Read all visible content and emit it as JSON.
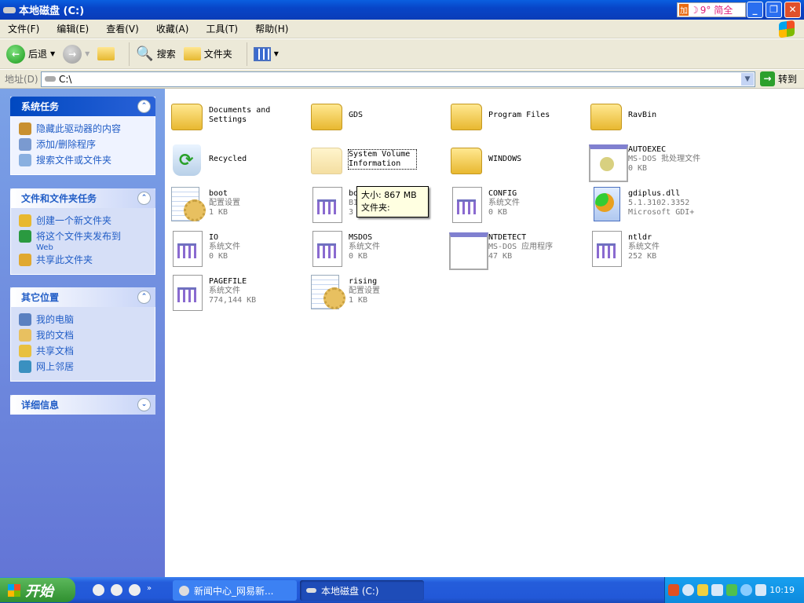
{
  "window": {
    "title": "本地磁盘 (C:)",
    "ime": {
      "badge": "加",
      "text": "9° 简全"
    },
    "minimize": "_",
    "restore": "❐",
    "close": "✕"
  },
  "menu": [
    "文件(F)",
    "编辑(E)",
    "查看(V)",
    "收藏(A)",
    "工具(T)",
    "帮助(H)"
  ],
  "toolbar": {
    "back": "后退",
    "search": "搜索",
    "folders": "文件夹"
  },
  "address": {
    "label": "地址(D)",
    "value": "C:\\",
    "go": "转到"
  },
  "panels": [
    {
      "title": "系统任务",
      "chev": "⌃",
      "items": [
        {
          "label": "隐藏此驱动器的内容",
          "color": "#c89030"
        },
        {
          "label": "添加/删除程序",
          "color": "#7a9ad0"
        },
        {
          "label": "搜索文件或文件夹",
          "color": "#8ab0e0"
        }
      ]
    },
    {
      "title": "文件和文件夹任务",
      "chev": "⌃",
      "items": [
        {
          "label": "创建一个新文件夹",
          "color": "#e8b830"
        },
        {
          "label": "将这个文件夹发布到",
          "sub": "Web",
          "color": "#2a9a40"
        },
        {
          "label": "共享此文件夹",
          "color": "#e0a830"
        }
      ]
    },
    {
      "title": "其它位置",
      "chev": "⌃",
      "items": [
        {
          "label": "我的电脑",
          "color": "#5a80c0"
        },
        {
          "label": "我的文档",
          "color": "#e8c060"
        },
        {
          "label": "共享文档",
          "color": "#e8c040"
        },
        {
          "label": "网上邻居",
          "color": "#3a90c0"
        }
      ]
    },
    {
      "title": "详细信息",
      "chev": "⌄",
      "items": []
    }
  ],
  "files": [
    {
      "name": "Documents and Settings",
      "icon": "folder"
    },
    {
      "name": "GDS",
      "icon": "folder"
    },
    {
      "name": "Program Files",
      "icon": "folder"
    },
    {
      "name": "RavBin",
      "icon": "folder"
    },
    {
      "name": "Recycled",
      "icon": "recycle"
    },
    {
      "name": "System Volume Information",
      "icon": "folder faded",
      "selected": true
    },
    {
      "name": "WINDOWS",
      "icon": "folder"
    },
    {
      "name": "AUTOEXEC",
      "icon": "exe bat",
      "type": "MS-DOS 批处理文件",
      "size": "0 KB"
    },
    {
      "name": "boot",
      "icon": "cfg",
      "type": "配置设置",
      "size": "1 KB"
    },
    {
      "name": "bo",
      "icon": "doc",
      "type": "BI",
      "size": "3"
    },
    {
      "name": "CONFIG",
      "icon": "doc",
      "type": "系统文件",
      "size": "0 KB"
    },
    {
      "name": "gdiplus.dll",
      "icon": "dll",
      "type": "5.1.3102.3352",
      "size": "Microsoft GDI+"
    },
    {
      "name": "IO",
      "icon": "doc",
      "type": "系统文件",
      "size": "0 KB"
    },
    {
      "name": "MSDOS",
      "icon": "doc",
      "type": "系统文件",
      "size": "0 KB"
    },
    {
      "name": "NTDETECT",
      "icon": "exe",
      "type": "MS-DOS 应用程序",
      "size": "47 KB"
    },
    {
      "name": "ntldr",
      "icon": "doc",
      "type": "系统文件",
      "size": "252 KB"
    },
    {
      "name": "PAGEFILE",
      "icon": "doc",
      "type": "系统文件",
      "size": "774,144 KB"
    },
    {
      "name": "rising",
      "icon": "cfg",
      "type": "配置设置",
      "size": "1 KB"
    }
  ],
  "tooltip": {
    "line1": "大小: 867 MB",
    "line2": "文件夹:"
  },
  "taskbar": {
    "start": "开始",
    "more": "»",
    "tasks": [
      "新闻中心_网易新...",
      "本地磁盘 (C:)"
    ],
    "clock": "10:19"
  }
}
